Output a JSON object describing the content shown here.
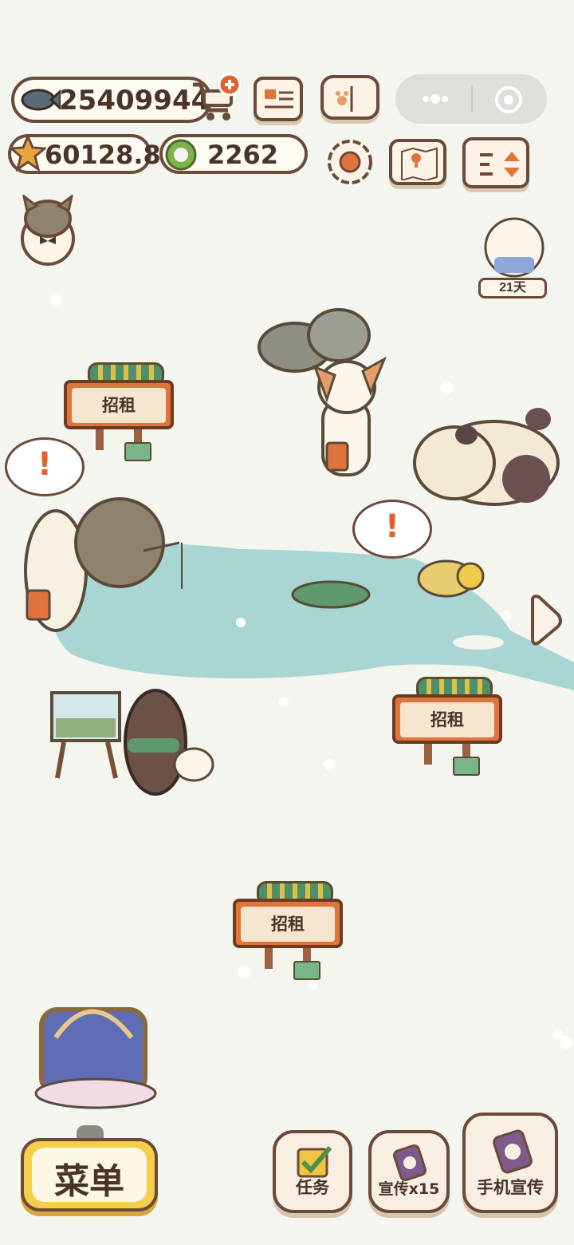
{
  "currency": {
    "fish": "25409944",
    "stars": "60128.8",
    "coins": "2262"
  },
  "event": {
    "days_label": "21天"
  },
  "signs": [
    {
      "label": "招租"
    },
    {
      "label": "招租"
    },
    {
      "label": "招租"
    }
  ],
  "menu": {
    "label": "菜单"
  },
  "actions": {
    "tasks_label": "任务",
    "promo_label": "宣传x15",
    "phone_promo_label": "手机宣传"
  },
  "icons": {
    "fish": "fish-icon",
    "cart": "cart-plus-icon",
    "star": "star-icon",
    "coin": "coin-icon",
    "news": "newspaper-icon",
    "book": "paw-book-icon",
    "settings": "gear-icon",
    "map": "map-icon",
    "sort": "sort-icon",
    "more": "more-dots-icon",
    "close": "target-close-icon",
    "arrow": "chevron-right-icon"
  },
  "colors": {
    "background": "#f3f5ee",
    "lake": "#a9d5d2",
    "outline": "#6b4a3a",
    "sign": "#e0743c",
    "menu_button": "#f6cf4a"
  }
}
